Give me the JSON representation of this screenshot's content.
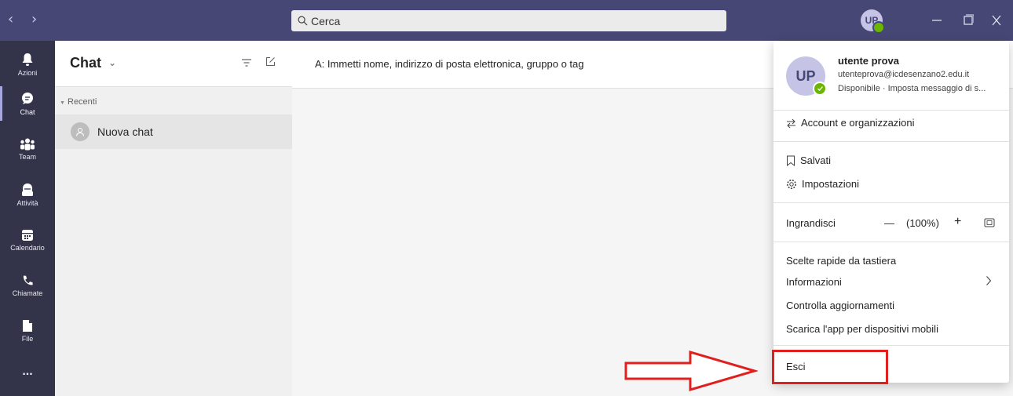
{
  "search": {
    "placeholder": "Cerca"
  },
  "user": {
    "initials": "UP"
  },
  "rail": [
    {
      "label": "Azioni",
      "icon": "bell-icon"
    },
    {
      "label": "Chat",
      "icon": "chat-icon"
    },
    {
      "label": "Team",
      "icon": "team-icon"
    },
    {
      "label": "Attività",
      "icon": "assignments-icon"
    },
    {
      "label": "Calendario",
      "icon": "calendar-icon"
    },
    {
      "label": "Chiamate",
      "icon": "phone-icon"
    },
    {
      "label": "File",
      "icon": "file-icon"
    },
    {
      "label": "...",
      "icon": "more-icon"
    }
  ],
  "chatlist": {
    "title": "Chat",
    "section": "Recenti",
    "items": [
      {
        "label": "Nuova chat"
      }
    ]
  },
  "compose": {
    "to_label": "A:  Immetti nome, indirizzo di posta elettronica, gruppo o tag"
  },
  "profile": {
    "initials": "UP",
    "name": "utente prova",
    "email": "utenteprova@icdesenzano2.edu.it",
    "status": "Disponibile · Imposta messaggio di s..."
  },
  "menu": {
    "account": "Account e organizzazioni",
    "saved": "Salvati",
    "settings": "Impostazioni",
    "zoom_label": "Ingrandisci",
    "zoom_minus": "—",
    "zoom_value": "(100%)",
    "zoom_plus": "+",
    "shortcuts": "Scelte rapide da tastiera",
    "about": "Informazioni",
    "updates": "Controlla aggiornamenti",
    "mobile": "Scarica l'app per dispositivi mobili",
    "signout": "Esci"
  },
  "colors": {
    "titlebar": "#464775",
    "rail": "#33344a",
    "annotation": "#e0201f",
    "status": "#6bb700"
  }
}
